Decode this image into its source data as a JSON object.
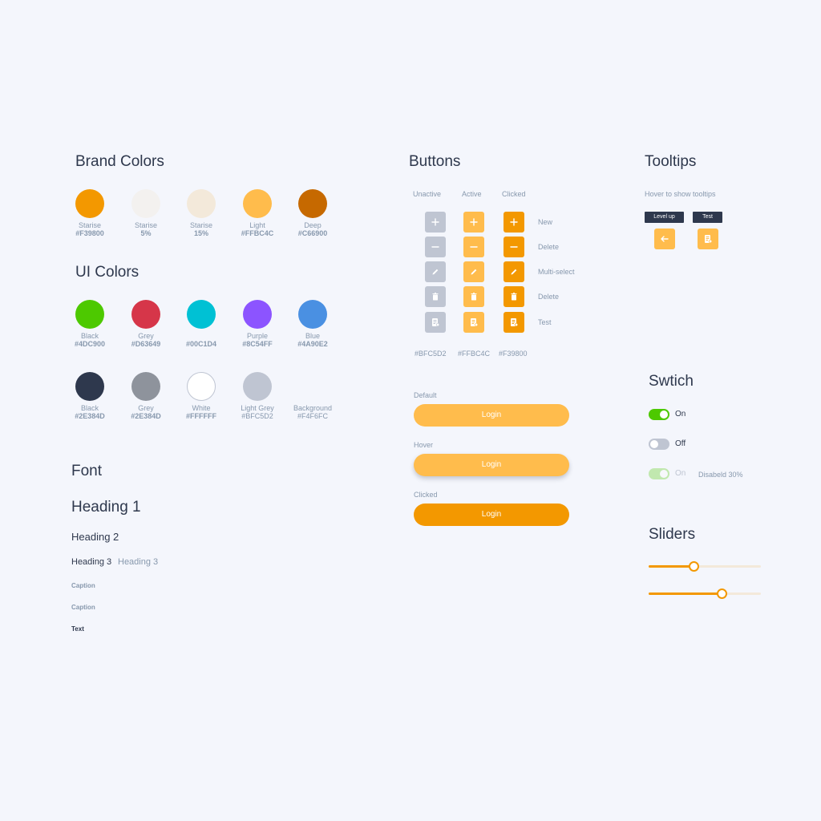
{
  "brand": {
    "title": "Brand Colors",
    "swatches": [
      {
        "name": "Starise",
        "value": "#F39800",
        "color": "#F39800"
      },
      {
        "name": "Starise",
        "value": "5%",
        "color": "#F3F1EF"
      },
      {
        "name": "Starise",
        "value": "15%",
        "color": "#F3E9DA"
      },
      {
        "name": "Light",
        "value": "#FFBC4C",
        "color": "#FFBC4C"
      },
      {
        "name": "Deep",
        "value": "#C66900",
        "color": "#C66900"
      }
    ]
  },
  "ui": {
    "title": "UI Colors",
    "row1": [
      {
        "name": "Black",
        "value": "#4DC900",
        "color": "#4DC900"
      },
      {
        "name": "Grey",
        "value": "#D63649",
        "color": "#D63649"
      },
      {
        "name": "",
        "value": "#00C1D4",
        "color": "#00C1D4"
      },
      {
        "name": "Purple",
        "value": "#8C54FF",
        "color": "#8C54FF"
      },
      {
        "name": "Blue",
        "value": "#4A90E2",
        "color": "#4A90E2"
      }
    ],
    "row2": [
      {
        "name": "Black",
        "value": "#2E384D",
        "color": "#2E384D"
      },
      {
        "name": "Grey",
        "value": "#2E384D",
        "color": "#8E939C"
      },
      {
        "name": "White",
        "value": "#FFFFFF",
        "color": "#FFFFFF"
      },
      {
        "name": "Light Grey",
        "value": "#BFC5D2",
        "color": "#BFC5D2"
      },
      {
        "name": "Background",
        "value": "#F4F6FC",
        "color": "#F4F6FC"
      }
    ]
  },
  "font": {
    "title": "Font",
    "h1": "Heading 1",
    "h2": "Heading 2",
    "h3": "Heading 3",
    "h3_light": "Heading 3",
    "caption1": "Caption",
    "caption2": "Caption",
    "text": "Text"
  },
  "buttons": {
    "title": "Buttons",
    "columns": [
      "Unactive",
      "Active",
      "Clicked"
    ],
    "column_colors": [
      "#BFC5D2",
      "#FFBC4C",
      "#F39800"
    ],
    "rows": [
      {
        "icon": "plus-icon",
        "label": "New"
      },
      {
        "icon": "minus-icon",
        "label": "Delete"
      },
      {
        "icon": "pencil-icon",
        "label": "Multi-select"
      },
      {
        "icon": "trash-icon",
        "label": "Delete"
      },
      {
        "icon": "document-icon",
        "label": "Test"
      }
    ],
    "hex_labels": [
      "#BFC5D2",
      "#FFBC4C",
      "#F39800"
    ],
    "login": [
      {
        "state": "Default",
        "label": "Login",
        "color": "#FFBC4C"
      },
      {
        "state": "Hover",
        "label": "Login",
        "color": "#FFBC4C"
      },
      {
        "state": "Clicked",
        "label": "Login",
        "color": "#F39800"
      }
    ]
  },
  "tooltips": {
    "title": "Tooltips",
    "hint": "Hover to show tooltips",
    "items": [
      {
        "tip": "Level up",
        "icon": "arrow-left-icon"
      },
      {
        "tip": "Test",
        "icon": "document-icon"
      }
    ]
  },
  "switch": {
    "title": "Swtich",
    "items": [
      {
        "label": "On",
        "state": "on",
        "color": "#4DC900"
      },
      {
        "label": "Off",
        "state": "off",
        "color": "#BFC5D2"
      },
      {
        "label": "On",
        "state": "disabled-on",
        "color": "#4DC900",
        "note": "Disabeld 30%"
      }
    ]
  },
  "sliders": {
    "title": "Sliders",
    "values": [
      0.4,
      0.65
    ],
    "accent": "#F39800"
  }
}
